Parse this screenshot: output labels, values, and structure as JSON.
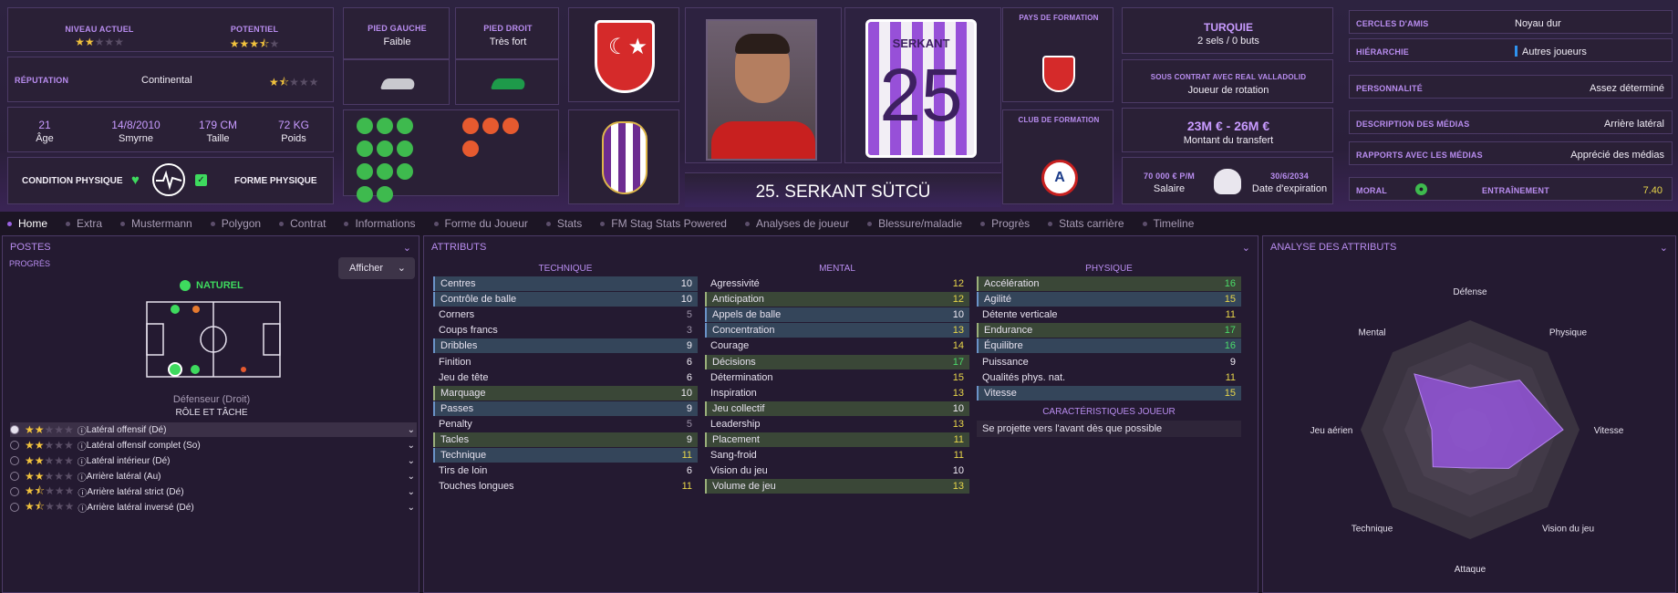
{
  "levels": {
    "current_label": "NIVEAU ACTUEL",
    "current_stars": 2,
    "potential_label": "POTENTIEL",
    "potential_stars": 3.5
  },
  "reputation": {
    "label": "RÉPUTATION",
    "value": "Continental",
    "stars": 1.5
  },
  "bio": {
    "age": "21",
    "age_label": "Âge",
    "dob": "14/8/2010",
    "city": "Smyrne",
    "height": "179 CM",
    "height_label": "Taille",
    "weight": "72 KG",
    "weight_label": "Poids"
  },
  "condition": {
    "label": "CONDITION PHYSIQUE",
    "form_label": "FORME PHYSIQUE"
  },
  "feet": {
    "left_label": "PIED GAUCHE",
    "left": "Faible",
    "right_label": "PIED DROIT",
    "right": "Très fort"
  },
  "player": {
    "name": "25. SERKANT SÜTCÜ",
    "shirt_name": "SERKANT",
    "shirt_number": "25"
  },
  "formation": {
    "country_label": "PAYS DE FORMATION",
    "club_label": "CLUB DE FORMATION"
  },
  "nation": {
    "name": "TURQUIE",
    "caps": "2 sels / 0 buts"
  },
  "contract": {
    "label": "SOUS CONTRAT AVEC REAL VALLADOLID",
    "role": "Joueur de rotation",
    "transfer": "23M € - 26M €",
    "transfer_label": "Montant du transfert",
    "wage": "70 000 € P/M",
    "wage_label": "Salaire",
    "expiry": "30/6/2034",
    "expiry_label": "Date d'expiration"
  },
  "social": [
    {
      "label": "CERCLES D'AMIS",
      "value": "Noyau dur"
    },
    {
      "label": "HIÉRARCHIE",
      "value": "Autres joueurs"
    },
    {
      "label": "PERSONNALITÉ",
      "value": "Assez déterminé"
    },
    {
      "label": "DESCRIPTION DES MÉDIAS",
      "value": "Arrière latéral"
    },
    {
      "label": "RAPPORTS AVEC LES MÉDIAS",
      "value": "Apprécié des médias"
    }
  ],
  "morale": {
    "label": "MORAL",
    "training_label": "ENTRAÎNEMENT",
    "training_value": "7.40"
  },
  "tabs": [
    "Home",
    "Extra",
    "Mustermann",
    "Polygon",
    "Contrat",
    "Informations",
    "Forme du Joueur",
    "Stats",
    "FM Stag Stats Powered",
    "Analyses de joueur",
    "Blessure/maladie",
    "Progrès",
    "Stats carrière",
    "Timeline"
  ],
  "positions": {
    "title": "POSTES",
    "progress": "PROGRÈS",
    "show_button": "Afficher",
    "natural": "NATUREL",
    "position_name": "Défenseur (Droit)",
    "role_header": "RÔLE ET TÂCHE",
    "roles": [
      {
        "name": "Latéral offensif (Dé)",
        "stars": 2
      },
      {
        "name": "Latéral offensif complet (So)",
        "stars": 2
      },
      {
        "name": "Latéral intérieur (Dé)",
        "stars": 2
      },
      {
        "name": "Arrière latéral (Au)",
        "stars": 2
      },
      {
        "name": "Arrière latéral strict (Dé)",
        "stars": 1.5
      },
      {
        "name": "Arrière latéral inversé (Dé)",
        "stars": 1.5
      }
    ]
  },
  "attributes": {
    "title": "ATTRIBUTS",
    "technique_label": "TECHNIQUE",
    "mental_label": "MENTAL",
    "physique_label": "PHYSIQUE",
    "technique": [
      {
        "n": "Centres",
        "v": "10",
        "c": "w",
        "h": "hl"
      },
      {
        "n": "Contrôle de balle",
        "v": "10",
        "c": "w",
        "h": "hl"
      },
      {
        "n": "Corners",
        "v": "5",
        "c": "gy",
        "h": ""
      },
      {
        "n": "Coups francs",
        "v": "3",
        "c": "gy",
        "h": ""
      },
      {
        "n": "Dribbles",
        "v": "9",
        "c": "w",
        "h": "hl"
      },
      {
        "n": "Finition",
        "v": "6",
        "c": "w",
        "h": ""
      },
      {
        "n": "Jeu de tête",
        "v": "6",
        "c": "w",
        "h": ""
      },
      {
        "n": "Marquage",
        "v": "10",
        "c": "w",
        "h": "hg"
      },
      {
        "n": "Passes",
        "v": "9",
        "c": "w",
        "h": "hl"
      },
      {
        "n": "Penalty",
        "v": "5",
        "c": "gy",
        "h": ""
      },
      {
        "n": "Tacles",
        "v": "9",
        "c": "w",
        "h": "hg"
      },
      {
        "n": "Technique",
        "v": "11",
        "c": "y",
        "h": "hl"
      },
      {
        "n": "Tirs de loin",
        "v": "6",
        "c": "w",
        "h": ""
      },
      {
        "n": "Touches longues",
        "v": "11",
        "c": "y",
        "h": ""
      }
    ],
    "mental": [
      {
        "n": "Agressivité",
        "v": "12",
        "c": "y",
        "h": ""
      },
      {
        "n": "Anticipation",
        "v": "12",
        "c": "y",
        "h": "hg"
      },
      {
        "n": "Appels de balle",
        "v": "10",
        "c": "w",
        "h": "hl"
      },
      {
        "n": "Concentration",
        "v": "13",
        "c": "y",
        "h": "hl"
      },
      {
        "n": "Courage",
        "v": "14",
        "c": "y",
        "h": ""
      },
      {
        "n": "Décisions",
        "v": "17",
        "c": "g",
        "h": "hg"
      },
      {
        "n": "Détermination",
        "v": "15",
        "c": "y",
        "h": ""
      },
      {
        "n": "Inspiration",
        "v": "13",
        "c": "y",
        "h": ""
      },
      {
        "n": "Jeu collectif",
        "v": "10",
        "c": "w",
        "h": "hg"
      },
      {
        "n": "Leadership",
        "v": "13",
        "c": "y",
        "h": ""
      },
      {
        "n": "Placement",
        "v": "11",
        "c": "y",
        "h": "hg"
      },
      {
        "n": "Sang-froid",
        "v": "11",
        "c": "y",
        "h": ""
      },
      {
        "n": "Vision du jeu",
        "v": "10",
        "c": "w",
        "h": ""
      },
      {
        "n": "Volume de jeu",
        "v": "13",
        "c": "y",
        "h": "hg"
      }
    ],
    "physique": [
      {
        "n": "Accélération",
        "v": "16",
        "c": "g",
        "h": "hg"
      },
      {
        "n": "Agilité",
        "v": "15",
        "c": "y",
        "h": "hl"
      },
      {
        "n": "Détente verticale",
        "v": "11",
        "c": "y",
        "h": ""
      },
      {
        "n": "Endurance",
        "v": "17",
        "c": "g",
        "h": "hg"
      },
      {
        "n": "Équilibre",
        "v": "16",
        "c": "g",
        "h": "hl"
      },
      {
        "n": "Puissance",
        "v": "9",
        "c": "w",
        "h": ""
      },
      {
        "n": "Qualités phys. nat.",
        "v": "11",
        "c": "y",
        "h": ""
      },
      {
        "n": "Vitesse",
        "v": "15",
        "c": "y",
        "h": "hl"
      }
    ],
    "traits_label": "CARACTÉRISTIQUES JOUEUR",
    "trait": "Se projette vers l'avant dès que possible"
  },
  "radar": {
    "title": "ANALYSE DES ATTRIBUTS",
    "labels": [
      "Défense",
      "Physique",
      "Vitesse",
      "Vision du jeu",
      "Attaque",
      "Technique",
      "Jeu aérien",
      "Mental"
    ],
    "values": [
      0.38,
      0.64,
      0.85,
      0.5,
      0.35,
      0.48,
      0.35,
      0.72
    ]
  }
}
